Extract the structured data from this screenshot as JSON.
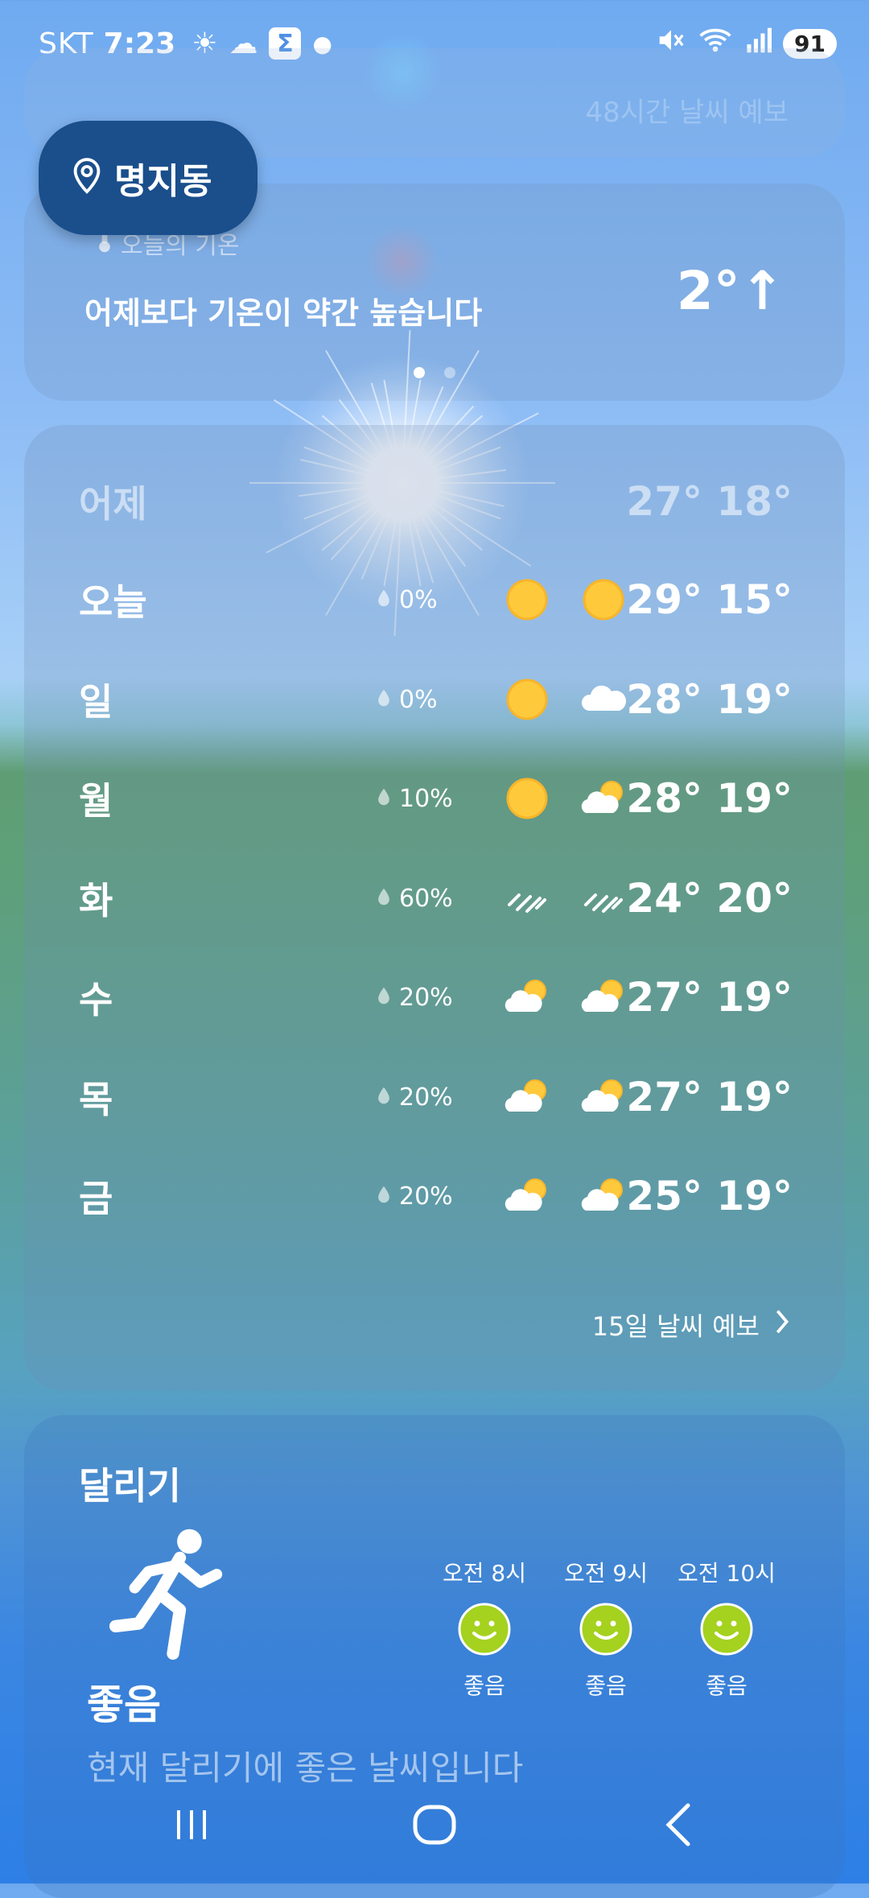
{
  "status_bar": {
    "carrier": "SKT",
    "time": "7:23",
    "battery": "91"
  },
  "location": {
    "name": "명지동"
  },
  "top_card": {
    "link_text": "48시간 날씨 예보"
  },
  "temp_card": {
    "subtitle": "오늘의 기온",
    "message": "어제보다 기온이 약간 높습니다",
    "value": "2°↑"
  },
  "week": {
    "rows": [
      {
        "day": "어제",
        "precip": "",
        "icon_day": "",
        "icon_night": "",
        "temps": "27° 18°"
      },
      {
        "day": "오늘",
        "precip": "0%",
        "icon_day": "sun-icon",
        "icon_night": "sun-icon",
        "temps": "29° 15°"
      },
      {
        "day": "일",
        "precip": "0%",
        "icon_day": "sun-icon",
        "icon_night": "cloud-icon",
        "temps": "28° 19°"
      },
      {
        "day": "월",
        "precip": "10%",
        "icon_day": "sun-icon",
        "icon_night": "partly-cloudy-icon",
        "temps": "28° 19°"
      },
      {
        "day": "화",
        "precip": "60%",
        "icon_day": "rain-icon",
        "icon_night": "rain-icon",
        "temps": "24° 20°"
      },
      {
        "day": "수",
        "precip": "20%",
        "icon_day": "partly-cloudy-icon",
        "icon_night": "partly-cloudy-icon",
        "temps": "27° 19°"
      },
      {
        "day": "목",
        "precip": "20%",
        "icon_day": "partly-cloudy-icon",
        "icon_night": "partly-cloudy-icon",
        "temps": "27° 19°"
      },
      {
        "day": "금",
        "precip": "20%",
        "icon_day": "partly-cloudy-icon",
        "icon_night": "partly-cloudy-icon",
        "temps": "25° 19°"
      }
    ],
    "link_text": "15일 날씨 예보"
  },
  "running": {
    "title": "달리기",
    "status": "좋음",
    "description": "현재 달리기에 좋은 날씨입니다",
    "slots": [
      {
        "time": "오전 8시",
        "label": "좋음"
      },
      {
        "time": "오전 9시",
        "label": "좋음"
      },
      {
        "time": "오전 10시",
        "label": "좋음"
      }
    ]
  },
  "colors": {
    "sun": "#ffc93c",
    "good_face": "#a5d11f",
    "chip": "#1a4f8c"
  }
}
